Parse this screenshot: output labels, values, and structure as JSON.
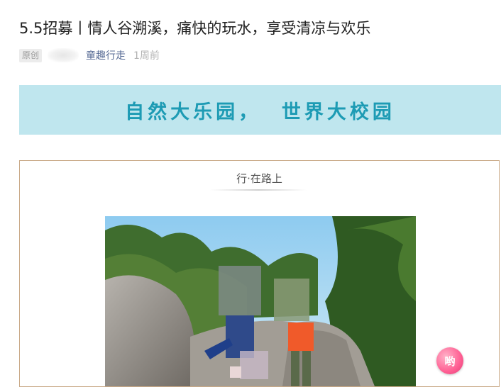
{
  "article": {
    "title": "5.5招募丨情人谷溯溪，痛快的玩水，享受清凉与欢乐",
    "original_badge": "原创",
    "author": "童趣行走",
    "time": "1周前"
  },
  "banner": {
    "text": "自然大乐园，  世界大校园"
  },
  "section": {
    "title": "行·在路上"
  },
  "floating_logo": {
    "text": "哟"
  },
  "colors": {
    "banner_bg": "#bfe6ee",
    "banner_text": "#1d9bb4",
    "author_link": "#576b95",
    "frame_border": "#c9a987"
  }
}
